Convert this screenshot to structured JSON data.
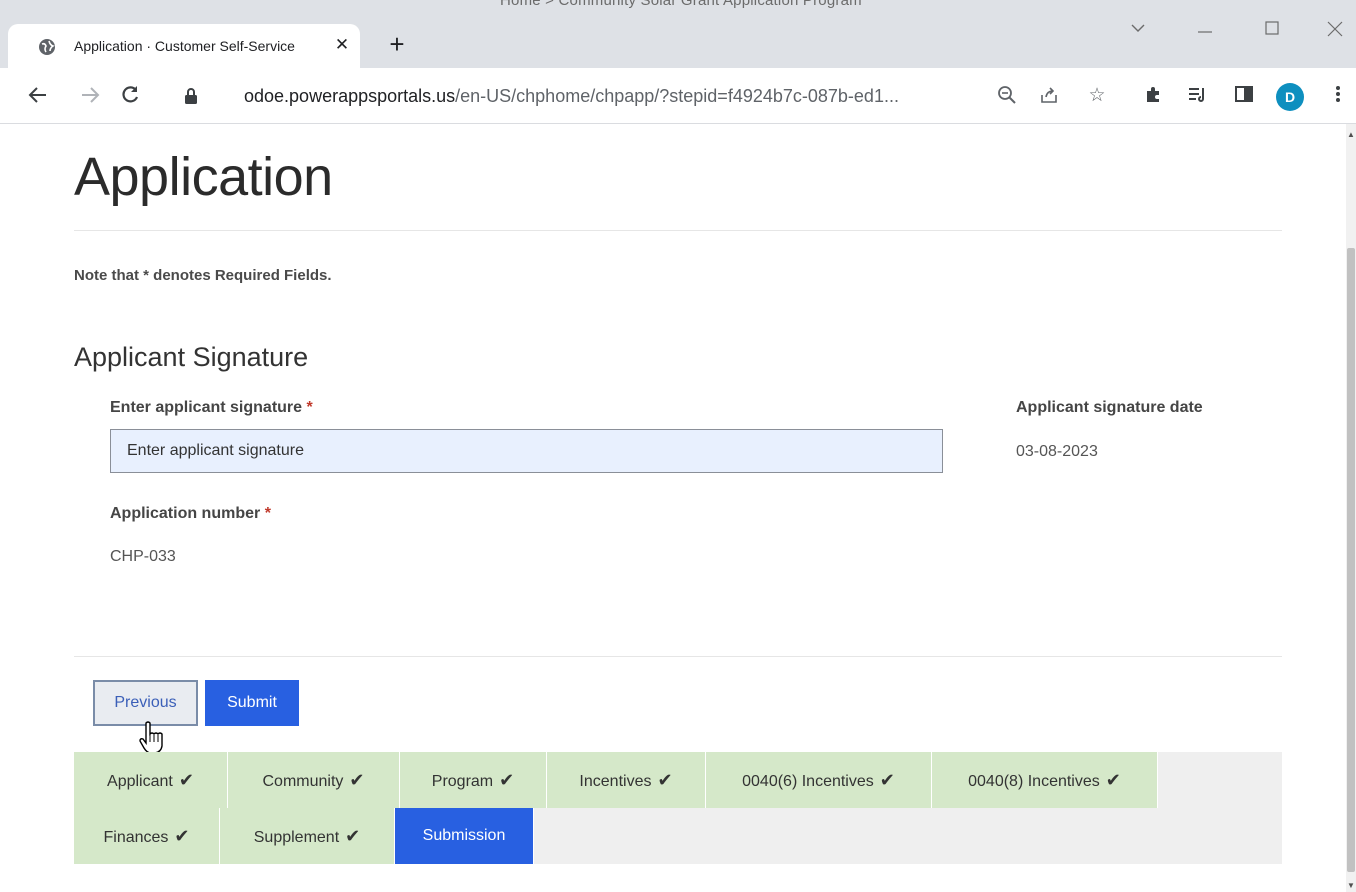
{
  "browser": {
    "ghost_breadcrumb": "Home  >  Community Solar Grant Application Program",
    "tab_title": "Application · Customer Self-Service",
    "new_tab_label": "+",
    "url_host": "odoe.powerappsportals.us",
    "url_path": "/en-US/chphome/chpapp/?stepid=f4924b7c-087b-ed1...",
    "profile_initial": "D"
  },
  "page": {
    "title": "Application",
    "note": "Note that * denotes Required Fields.",
    "section_title": "Applicant Signature"
  },
  "form": {
    "signature_label": "Enter applicant signature",
    "signature_placeholder": "Enter applicant signature",
    "signature_date_label": "Applicant signature date",
    "signature_date_value": "03-08-2023",
    "application_number_label": "Application number",
    "application_number_value": "CHP-033",
    "required_marker": "*"
  },
  "buttons": {
    "previous": "Previous",
    "submit": "Submit"
  },
  "steps": [
    {
      "label": "Applicant",
      "done": true
    },
    {
      "label": "Community",
      "done": true
    },
    {
      "label": "Program",
      "done": true
    },
    {
      "label": "Incentives",
      "done": true
    },
    {
      "label": "0040(6) Incentives",
      "done": true
    },
    {
      "label": "0040(8) Incentives",
      "done": true
    },
    {
      "label": "Finances",
      "done": true
    },
    {
      "label": "Supplement",
      "done": true
    },
    {
      "label": "Submission",
      "done": false,
      "active": true
    }
  ],
  "check_glyph": "✔",
  "colors": {
    "primary_button": "#2860e1",
    "step_done": "#d5e8c9",
    "step_active": "#2860e1",
    "input_bg": "#e8f0fe",
    "required": "#c0392b",
    "profile": "#0e8fbf"
  }
}
